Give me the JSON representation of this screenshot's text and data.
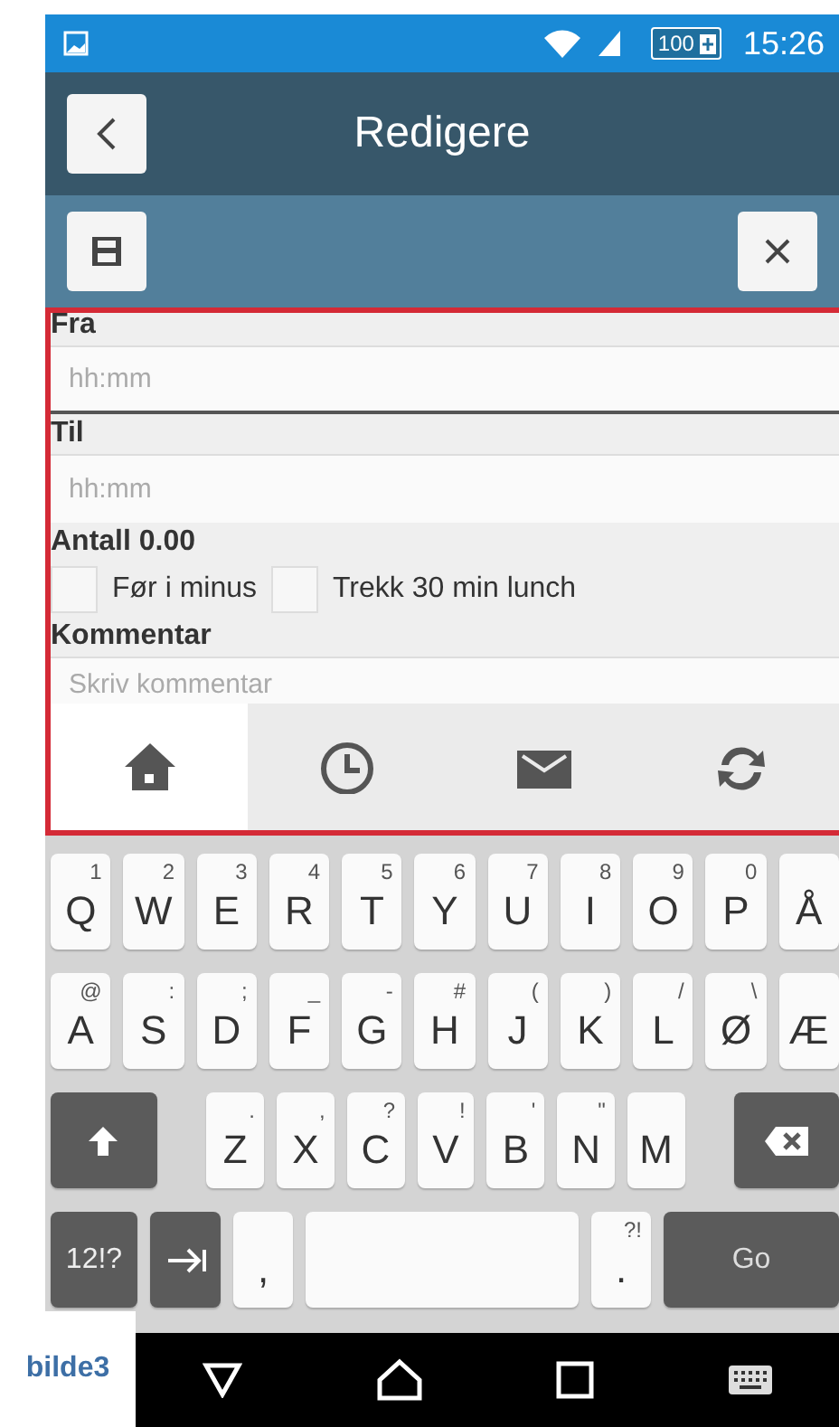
{
  "status_bar": {
    "battery": "100",
    "time": "15:26"
  },
  "header": {
    "title": "Redigere"
  },
  "form": {
    "fields": [
      {
        "label": "Fra",
        "placeholder": "hh:mm"
      },
      {
        "label": "Til",
        "placeholder": "hh:mm"
      }
    ],
    "total": "Antall 0.00",
    "checkboxes": [
      {
        "label": "Før i minus",
        "checked": false
      },
      {
        "label": "Trekk 30 min lunch",
        "checked": false
      }
    ],
    "comment": {
      "label": "Kommentar",
      "placeholder": "Skriv kommentar"
    }
  },
  "tabs": [
    {
      "kind": "home",
      "selected": true
    },
    {
      "kind": "clock",
      "selected": false
    },
    {
      "kind": "mail",
      "selected": false
    },
    {
      "kind": "sync",
      "selected": false
    }
  ],
  "keyboard": {
    "rows": [
      [
        {
          "label": "Q",
          "hint": "1"
        },
        {
          "label": "W",
          "hint": "2"
        },
        {
          "label": "E",
          "hint": "3"
        },
        {
          "label": "R",
          "hint": "4"
        },
        {
          "label": "T",
          "hint": "5"
        },
        {
          "label": "Y",
          "hint": "6"
        },
        {
          "label": "U",
          "hint": "7"
        },
        {
          "label": "I",
          "hint": "8"
        },
        {
          "label": "O",
          "hint": "9"
        },
        {
          "label": "P",
          "hint": "0"
        },
        {
          "label": "Å"
        }
      ],
      [
        {
          "label": "A",
          "hint": "@"
        },
        {
          "label": "S",
          "hint": ":"
        },
        {
          "label": "D",
          "hint": ";"
        },
        {
          "label": "F",
          "hint": "_"
        },
        {
          "label": "G",
          "hint": "-"
        },
        {
          "label": "H",
          "hint": "#"
        },
        {
          "label": "J",
          "hint": "("
        },
        {
          "label": "K",
          "hint": ")"
        },
        {
          "label": "L",
          "hint": "/"
        },
        {
          "label": "Ø",
          "hint": "\\"
        },
        {
          "label": "Æ"
        }
      ],
      [
        {
          "kind": "shift"
        },
        {
          "kind": "spacer"
        },
        {
          "label": "Z",
          "hint": "."
        },
        {
          "label": "X",
          "hint": ","
        },
        {
          "label": "C",
          "hint": "?"
        },
        {
          "label": "V",
          "hint": "!"
        },
        {
          "label": "B",
          "hint": "'"
        },
        {
          "label": "N",
          "hint": "\""
        },
        {
          "label": "M"
        },
        {
          "kind": "spacer"
        },
        {
          "kind": "backspace"
        }
      ]
    ],
    "bottom_row": [
      {
        "kind": "symbols",
        "label": "12!?"
      },
      {
        "kind": "tab"
      },
      {
        "kind": "comma",
        "label": ","
      },
      {
        "kind": "space"
      },
      {
        "kind": "period",
        "label": ".",
        "hint": "?!"
      },
      {
        "kind": "go",
        "label": "Go"
      }
    ]
  },
  "caption": "bilde3"
}
